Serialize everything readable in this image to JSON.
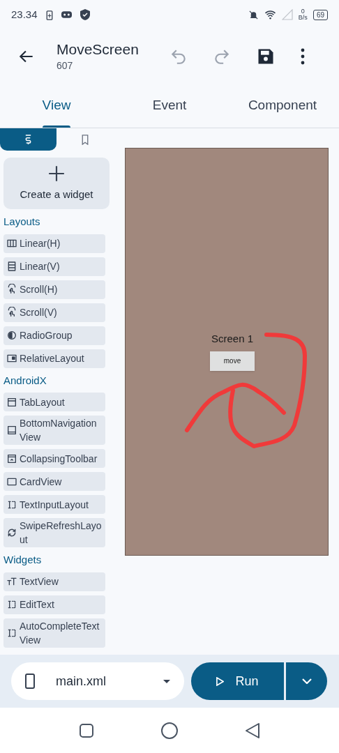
{
  "status_bar": {
    "time": "23.34",
    "net_speed_value": "0",
    "net_speed_unit": "B/s",
    "battery": "69"
  },
  "app_bar": {
    "title": "MoveScreen",
    "subtitle": "607"
  },
  "tabs": [
    {
      "label": "View",
      "selected": true
    },
    {
      "label": "Event",
      "selected": false
    },
    {
      "label": "Component",
      "selected": false
    }
  ],
  "palette_tabs": [
    {
      "selected": true
    },
    {
      "selected": false
    }
  ],
  "create_widget": "Create a widget",
  "sections": [
    {
      "title": "Layouts",
      "items": [
        "Linear(H)",
        "Linear(V)",
        "Scroll(H)",
        "Scroll(V)",
        "RadioGroup",
        "RelativeLayout"
      ]
    },
    {
      "title": "AndroidX",
      "items": [
        "TabLayout",
        "BottomNavigationView",
        "CollapsingToolbar",
        "CardView",
        "TextInputLayout",
        "SwipeRefreshLayout"
      ]
    },
    {
      "title": "Widgets",
      "items": [
        "TextView",
        "EditText",
        "AutoCompleteTextView"
      ]
    }
  ],
  "preview": {
    "label": "Screen 1",
    "button": "move"
  },
  "bottom_bar": {
    "file": "main.xml",
    "run": "Run"
  }
}
